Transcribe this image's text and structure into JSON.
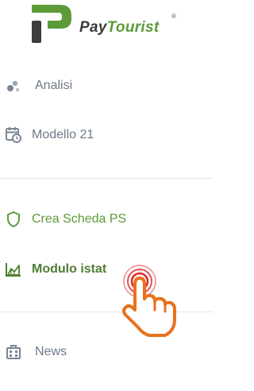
{
  "brand": {
    "name_part1": "Pay",
    "name_part2": "Tourist",
    "registered_mark": "®",
    "colors": {
      "dark": "#3a3a3a",
      "green": "#5c9a3a"
    }
  },
  "menu": {
    "group1": [
      {
        "label": "Analisi",
        "icon": "scatter-dots-icon",
        "color": "#7a8a9a"
      },
      {
        "label": "Modello 21",
        "icon": "calendar-clock-icon",
        "color": "#7a8a9a"
      }
    ],
    "group2": [
      {
        "label": "Crea Scheda PS",
        "icon": "shield-icon",
        "color": "#5c9a3a"
      },
      {
        "label": "Modulo istat",
        "icon": "area-chart-icon",
        "color": "#5c9a3a",
        "active": true
      }
    ],
    "group3": [
      {
        "label": "News",
        "icon": "news-building-icon",
        "color": "#7a8a9a"
      }
    ]
  },
  "cursor": {
    "icon": "hand-pointer-icon",
    "ring_color": "#e0262b",
    "hand_color": "#e8721c"
  }
}
